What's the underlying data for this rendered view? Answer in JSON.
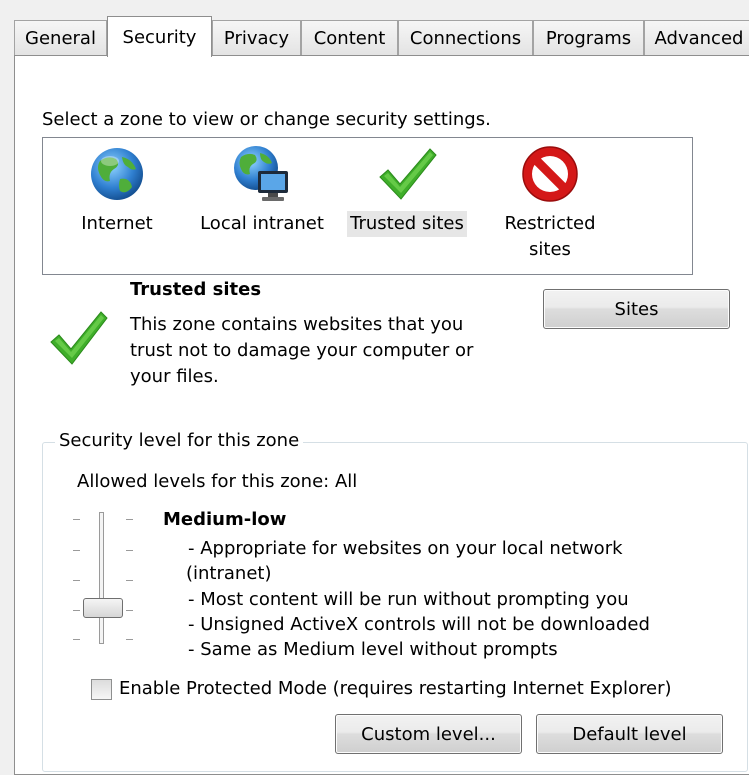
{
  "tabs": [
    {
      "label": "General"
    },
    {
      "label": "Security"
    },
    {
      "label": "Privacy"
    },
    {
      "label": "Content"
    },
    {
      "label": "Connections"
    },
    {
      "label": "Programs"
    },
    {
      "label": "Advanced"
    }
  ],
  "zone_prompt": "Select a zone to view or change security settings.",
  "zones": [
    {
      "label": "Internet",
      "icon": "globe-icon"
    },
    {
      "label": "Local intranet",
      "icon": "globe-computer-icon"
    },
    {
      "label": "Trusted sites",
      "icon": "green-check-icon",
      "selected": true
    },
    {
      "label_line1": "Restricted",
      "label_line2": "sites",
      "icon": "no-entry-icon"
    }
  ],
  "zone_info": {
    "title": "Trusted sites",
    "desc_line1": "This zone contains websites that you",
    "desc_line2": "trust not to damage your computer or",
    "desc_line3": "your files."
  },
  "sites_button": "Sites",
  "security_level": {
    "group_label": "Security level for this zone",
    "allowed_levels": "Allowed levels for this zone: All",
    "level_name": "Medium-low",
    "slider_value": "Medium-low (2 of 5)",
    "desc": [
      "- Appropriate for websites on your local network",
      "(intranet)",
      "- Most content will be run without prompting you",
      "- Unsigned ActiveX controls will not be downloaded",
      "- Same as Medium level without prompts"
    ]
  },
  "protected_mode": {
    "label": "Enable Protected Mode (requires restarting Internet Explorer)",
    "checked": false
  },
  "custom_level_button": "Custom level...",
  "default_level_button": "Default level",
  "colors": {
    "check_green": "#3fae2a",
    "no_entry_red": "#d41818",
    "globe_blue": "#2f7fd0"
  }
}
